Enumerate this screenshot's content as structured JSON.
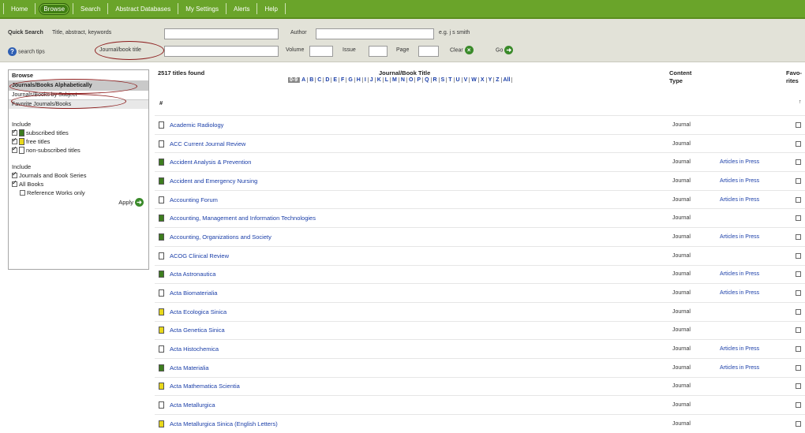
{
  "nav": {
    "tabs": [
      {
        "label": "Home"
      },
      {
        "label": "Browse",
        "active": true
      },
      {
        "label": "Search"
      },
      {
        "label": "Abstract Databases"
      },
      {
        "label": "My Settings"
      },
      {
        "label": "Alerts"
      },
      {
        "label": "Help"
      }
    ]
  },
  "quick_search": {
    "label": "Quick Search",
    "keywords_label": "Title, abstract, keywords",
    "author_label": "Author",
    "author_hint": "e.g. j s smith",
    "journal_label": "Journal/book title",
    "volume_label": "Volume",
    "issue_label": "Issue",
    "page_label": "Page",
    "search_tips": "search tips",
    "clear_label": "Clear",
    "go_label": "Go"
  },
  "sidebar": {
    "browse_label": "Browse",
    "items": [
      {
        "label": "Journals/Books Alphabetically",
        "active": true
      },
      {
        "label": "Journals/Books by Subject"
      },
      {
        "label": "Favorite Journals/Books"
      }
    ],
    "include_label": "Include",
    "filters1": [
      {
        "label": "subscribed titles",
        "color": "#3d7d1e"
      },
      {
        "label": "free titles",
        "color": "#e8d81a"
      },
      {
        "label": "non-subscribed titles",
        "color": "#ffffff"
      }
    ],
    "include2_label": "Include",
    "filters2": [
      {
        "label": "Journals and Book Series",
        "checked": true
      },
      {
        "label": "All Books",
        "checked": true
      },
      {
        "label": "Reference Works only",
        "checked": false
      }
    ],
    "apply_label": "Apply"
  },
  "results": {
    "count_text": "2517 titles found",
    "title_header": "Journal/Book Title",
    "letters": [
      "0-9",
      "A",
      "B",
      "C",
      "D",
      "E",
      "F",
      "G",
      "H",
      "I",
      "J",
      "K",
      "L",
      "M",
      "N",
      "O",
      "P",
      "Q",
      "R",
      "S",
      "T",
      "U",
      "V",
      "W",
      "X",
      "Y",
      "Z",
      "All"
    ],
    "content_type_header": [
      "Content",
      "Type"
    ],
    "fav_header": [
      "Favo-",
      "rites"
    ],
    "section_letter": "#",
    "rows": [
      {
        "title": "Academic Radiology",
        "type": "Journal",
        "aip": "",
        "access": "non"
      },
      {
        "title": "ACC Current Journal Review",
        "type": "Journal",
        "aip": "",
        "access": "non"
      },
      {
        "title": "Accident Analysis & Prevention",
        "type": "Journal",
        "aip": "Articles in Press",
        "access": "sub"
      },
      {
        "title": "Accident and Emergency Nursing",
        "type": "Journal",
        "aip": "Articles in Press",
        "access": "sub"
      },
      {
        "title": "Accounting Forum",
        "type": "Journal",
        "aip": "Articles in Press",
        "access": "non"
      },
      {
        "title": "Accounting, Management and Information Technologies",
        "type": "Journal",
        "aip": "",
        "access": "sub"
      },
      {
        "title": "Accounting, Organizations and Society",
        "type": "Journal",
        "aip": "Articles in Press",
        "access": "sub"
      },
      {
        "title": "ACOG Clinical Review",
        "type": "Journal",
        "aip": "",
        "access": "non"
      },
      {
        "title": "Acta Astronautica",
        "type": "Journal",
        "aip": "Articles in Press",
        "access": "sub"
      },
      {
        "title": "Acta Biomaterialia",
        "type": "Journal",
        "aip": "Articles in Press",
        "access": "non"
      },
      {
        "title": "Acta Ecologica Sinica",
        "type": "Journal",
        "aip": "",
        "access": "free"
      },
      {
        "title": "Acta Genetica Sinica",
        "type": "Journal",
        "aip": "",
        "access": "free"
      },
      {
        "title": "Acta Histochemica",
        "type": "Journal",
        "aip": "Articles in Press",
        "access": "non"
      },
      {
        "title": "Acta Materialia",
        "type": "Journal",
        "aip": "Articles in Press",
        "access": "sub"
      },
      {
        "title": "Acta Mathematica Scientia",
        "type": "Journal",
        "aip": "",
        "access": "free"
      },
      {
        "title": "Acta Metallurgica",
        "type": "Journal",
        "aip": "",
        "access": "non"
      },
      {
        "title": "Acta Metallurgica Sinica (English Letters)",
        "type": "Journal",
        "aip": "",
        "access": "free"
      }
    ]
  },
  "colors": {
    "nav": "#6aa42a",
    "subscribed": "#3d7d1e",
    "free": "#e8d81a",
    "annotation": "#8c1c1c"
  }
}
